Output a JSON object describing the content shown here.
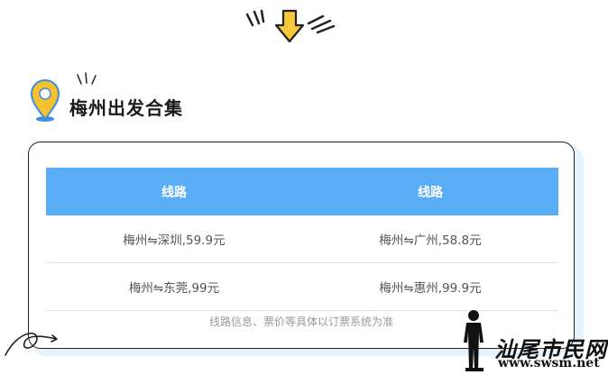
{
  "section": {
    "title": "梅州出发合集"
  },
  "table": {
    "headers": [
      "线路",
      "线路"
    ],
    "rows": [
      [
        "梅州⇋深圳,59.9元",
        "梅州⇋广州,58.8元"
      ],
      [
        "梅州⇋东莞,99元",
        "梅州⇋惠州,99.9元"
      ]
    ],
    "footnote": "线路信息、票价等具体以订票系统为准"
  },
  "watermark": {
    "brand": "汕尾市民网",
    "url": "www.swsm.net"
  },
  "colors": {
    "header_bg": "#5aaef5",
    "arrow_yellow": "#f7c83a",
    "pin_yellow": "#f5c12e",
    "pin_blue": "#3f8fe0"
  },
  "icons": [
    "down-arrow-icon",
    "location-pin-icon",
    "sparkle-lines-icon",
    "squiggle-decoration",
    "person-silhouette"
  ]
}
